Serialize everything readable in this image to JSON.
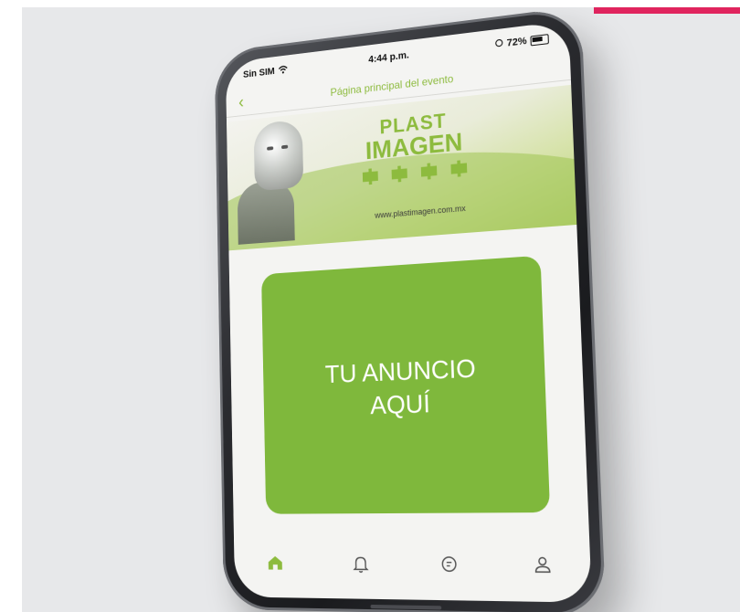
{
  "status_bar": {
    "carrier": "Sin SIM",
    "time": "4:44 p.m.",
    "battery": "72%"
  },
  "nav": {
    "title": "Página principal del evento",
    "back_label": "‹"
  },
  "banner": {
    "brand_line1": "PLAST",
    "brand_line2": "IMAGEN",
    "url": "www.plastimagen.com.mx"
  },
  "ad": {
    "text": "TU ANUNCIO AQUÍ"
  },
  "tabs": [
    {
      "icon": "home-icon",
      "active": true
    },
    {
      "icon": "bell-icon",
      "active": false
    },
    {
      "icon": "chat-icon",
      "active": false
    },
    {
      "icon": "user-icon",
      "active": false
    }
  ],
  "colors": {
    "accent": "#8dbb3e",
    "ad_background": "#7fb83c",
    "corner_accent": "#e0245e",
    "inactive_icon": "#555555"
  }
}
